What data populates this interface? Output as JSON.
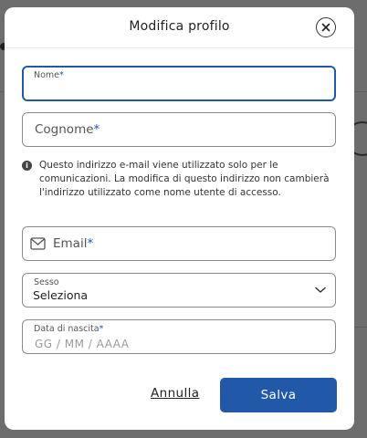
{
  "modal": {
    "title": "Modifica profilo"
  },
  "form": {
    "first_name": {
      "label": "Nome",
      "required_mark": "*",
      "value": ""
    },
    "last_name": {
      "label": "Cognome",
      "required_mark": "*",
      "value": ""
    },
    "info_text": "Questo indirizzo e-mail viene utilizzato solo per le comunicazioni. La modifica di questo indirizzo non cambierà l'indirizzo utilizzato come nome utente di accesso.",
    "email": {
      "label": "Email",
      "required_mark": "*",
      "value": ""
    },
    "gender": {
      "label": "Sesso",
      "selected": "Seleziona"
    },
    "birth_date": {
      "label": "Data di nascita",
      "required_mark": "*",
      "placeholder": "GG / MM / AAAA"
    }
  },
  "actions": {
    "cancel_label": "Annulla",
    "save_label": "Salva"
  },
  "colors": {
    "accent": "#2159a8",
    "overlay": "#6f6f6f"
  },
  "icons": {
    "close": "close-icon",
    "info": "info-icon",
    "email": "envelope-icon",
    "dropdown": "chevron-down-icon"
  }
}
